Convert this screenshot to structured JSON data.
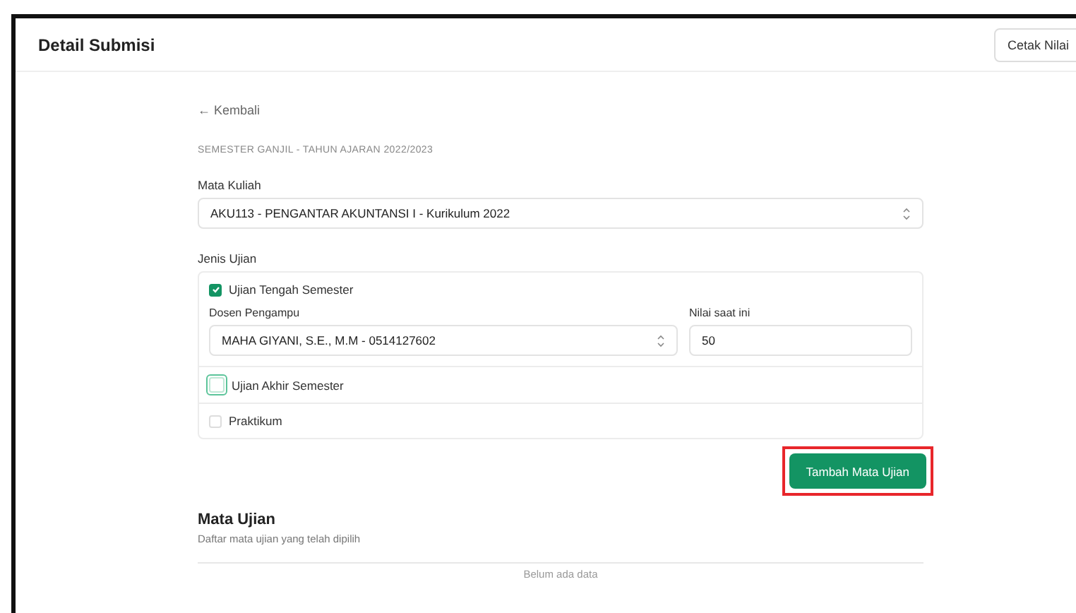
{
  "header": {
    "title": "Detail Submisi",
    "print_button": "Cetak Nilai"
  },
  "back_link": "← Kembali",
  "semester": "SEMESTER GANJIL - TAHUN AJARAN 2022/2023",
  "course": {
    "label": "Mata Kuliah",
    "value": "AKU113 - PENGANTAR AKUNTANSI I - Kurikulum 2022"
  },
  "exam_types": {
    "label": "Jenis Ujian",
    "items": [
      {
        "label": "Ujian Tengah Semester",
        "checked": true,
        "focused": false,
        "lecturer_label": "Dosen Pengampu",
        "lecturer": "MAHA GIYANI, S.E., M.M - 0514127602",
        "score_label": "Nilai saat ini",
        "score": "50"
      },
      {
        "label": "Ujian Akhir Semester",
        "checked": false,
        "focused": true
      },
      {
        "label": "Praktikum",
        "checked": false,
        "focused": false
      }
    ]
  },
  "add_button": {
    "label": "Tambah Mata Ujian",
    "highlighted": true
  },
  "exam_list": {
    "title": "Mata Ujian",
    "subtitle": "Daftar mata ujian yang telah dipilih",
    "empty": "Belum ada data"
  }
}
